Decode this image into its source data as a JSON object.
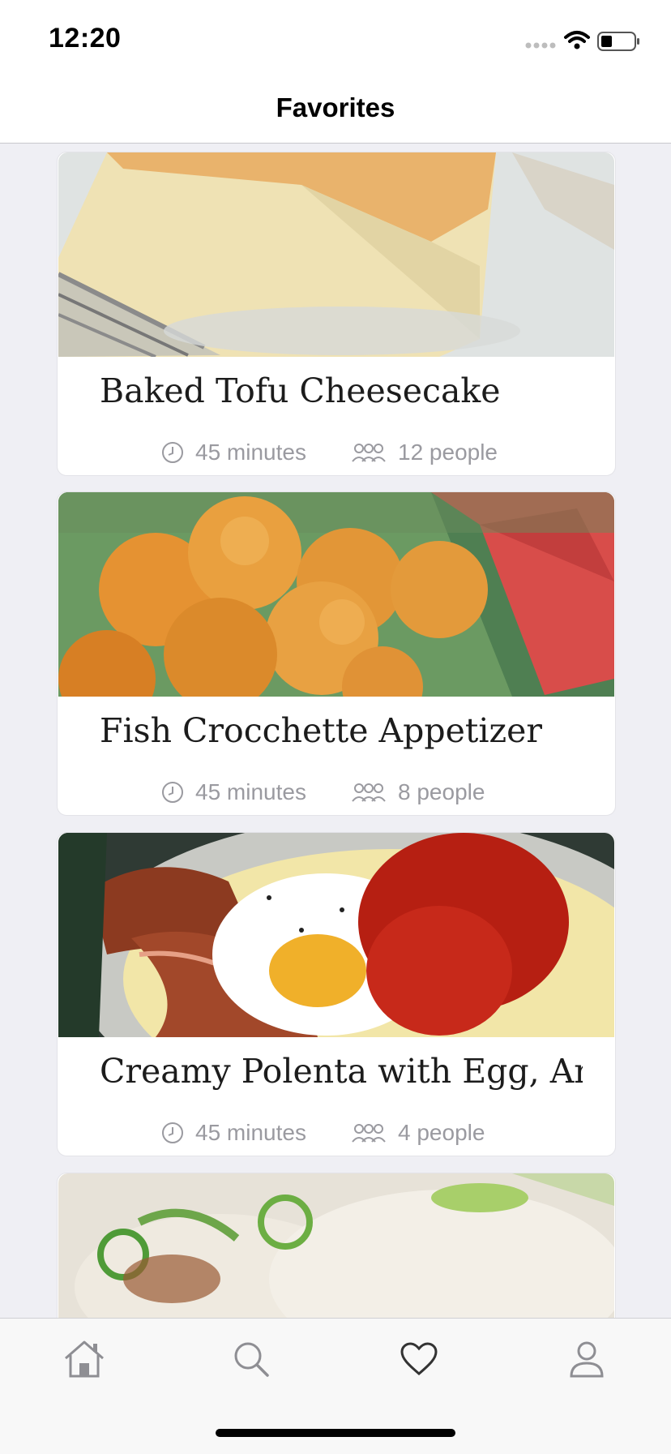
{
  "status_bar": {
    "time": "12:20"
  },
  "nav": {
    "title": "Favorites"
  },
  "recipes": [
    {
      "title": "Baked Tofu Cheesecake",
      "time": "45 minutes",
      "servings": "12 people"
    },
    {
      "title": "Fish Crocchette Appetizer",
      "time": "45 minutes",
      "servings": "8 people"
    },
    {
      "title": "Creamy Polenta with Egg, Arra...",
      "time": "45 minutes",
      "servings": "4 people"
    }
  ],
  "tab_bar": {
    "items": [
      {
        "icon": "home-icon"
      },
      {
        "icon": "search-icon"
      },
      {
        "icon": "heart-icon",
        "selected": true
      },
      {
        "icon": "profile-icon"
      }
    ]
  },
  "colors": {
    "background": "#efeff4",
    "meta_text": "#9a9aa0",
    "tab_icon": "#8e8e93"
  }
}
